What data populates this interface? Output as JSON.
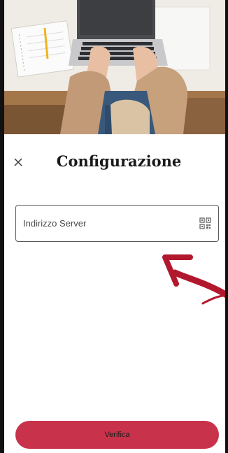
{
  "hero": {
    "description_icon": "laptop-desk-photo"
  },
  "header": {
    "title": "Configurazione",
    "close_icon": "close-icon"
  },
  "server_field": {
    "placeholder": "Indirizzo Server",
    "value": "",
    "qr_icon": "qr-code-icon"
  },
  "actions": {
    "verify_label": "Verifica"
  },
  "colors": {
    "primary": "#c8324a",
    "arrow": "#b1182e",
    "text": "#1a1a1a"
  }
}
